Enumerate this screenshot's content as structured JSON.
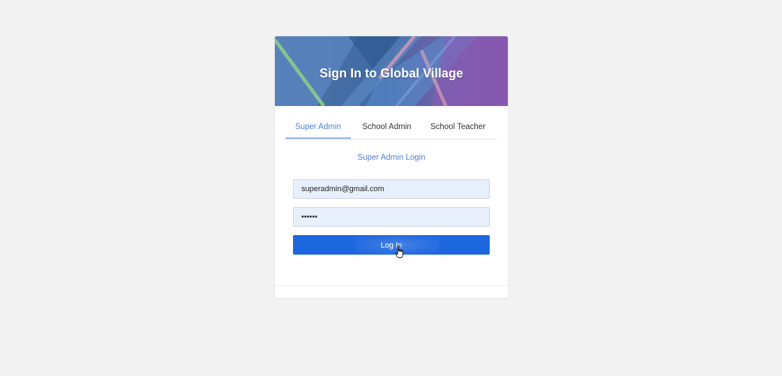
{
  "banner": {
    "title": "Sign In to Global Village"
  },
  "tabs": [
    {
      "label": "Super Admin",
      "active": true
    },
    {
      "label": "School Admin",
      "active": false
    },
    {
      "label": "School Teacher",
      "active": false
    }
  ],
  "form": {
    "subtitle": "Super Admin Login",
    "email_value": "superadmin@gmail.com",
    "password_masked": "••••••",
    "login_label": "Log In"
  },
  "colors": {
    "accent": "#4d7fd6",
    "button": "#1d67de",
    "input_bg": "#e8f0fd",
    "page_bg": "#f2f2f3"
  },
  "icons": {
    "cursor": "hand-pointer-icon"
  }
}
